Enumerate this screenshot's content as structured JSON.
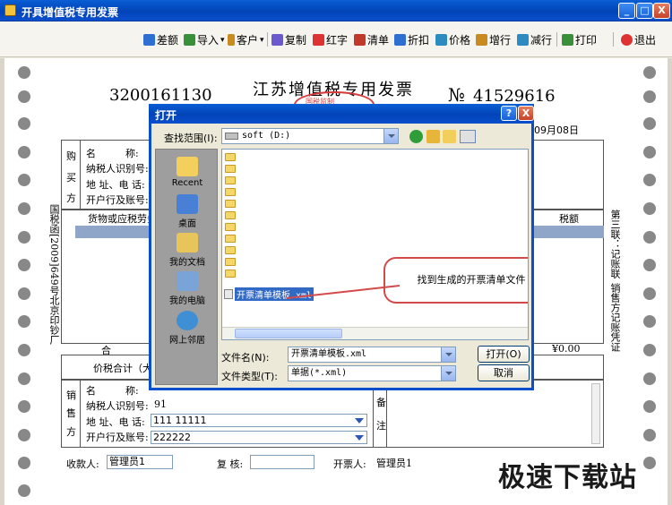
{
  "window": {
    "title": "开具增值税专用发票",
    "min_label": "_",
    "max_label": "□",
    "close_label": "X"
  },
  "toolbar": {
    "items": [
      {
        "label": "差额",
        "color": "#2e6fd1"
      },
      {
        "label": "导入",
        "color": "#3a8f3a"
      },
      {
        "label": "客户",
        "color": "#c98a1f"
      },
      {
        "label": "复制",
        "color": "#6a5acd"
      },
      {
        "label": "红字",
        "color": "#d33"
      },
      {
        "label": "清单",
        "color": "#c0392b"
      },
      {
        "label": "折扣",
        "color": "#2e6fd1"
      },
      {
        "label": "价格",
        "color": "#2e8bc0"
      },
      {
        "label": "增行",
        "color": "#c98a1f"
      },
      {
        "label": "减行",
        "color": "#2e8bc0"
      },
      {
        "label": "打印",
        "color": "#3a8f3a"
      },
      {
        "label": "退出",
        "color": "#d33"
      }
    ],
    "import_arrow": "▾",
    "customer_arrow": "▾"
  },
  "invoice": {
    "title": "江苏增值税专用发票",
    "code": "3200161130",
    "no_label": "№",
    "no_value": "41529616",
    "date": "09月08日",
    "seal_text": "国税监制",
    "buyer_vertical": [
      "购",
      "买",
      "方"
    ],
    "buyer_labels": [
      "名　　　称:",
      "纳税人识别号:",
      "地 址、电 话:",
      "开户行及账号:"
    ],
    "goods_header": "货物或应税劳务、",
    "tax_header": "税额",
    "total_label": "合",
    "total_tax": "¥0.00",
    "price_tax_label": "价税合计（大",
    "left_vertical": "国税函[2009]649号北京印钞厂",
    "right_vertical_1": "第三联：记账联",
    "right_vertical_2": "销售方记账凭证",
    "seller_vertical": [
      "销",
      "售",
      "方"
    ],
    "seller_labels": [
      "名　　　称:",
      "纳税人识别号:",
      "地 址、电 话:",
      "开户行及账号:"
    ],
    "seller_tax_id": "91",
    "seller_address": "111 11111",
    "seller_bank": "222222",
    "remark_vertical": [
      "备",
      "注"
    ],
    "payee_label": "收款人:",
    "payee_value": "管理员1",
    "reviewer_label": "复 核:",
    "reviewer_value": "",
    "drawer_label": "开票人:",
    "drawer_value": "管理员1"
  },
  "watermark": "极速下载站",
  "dialog": {
    "title": "打开",
    "help_label": "?",
    "close_label": "X",
    "lookin_label": "查找范围(I):",
    "lookin_value": "soft (D:)",
    "places": [
      "Recent",
      "桌面",
      "我的文档",
      "我的电脑",
      "网上邻居"
    ],
    "file_name": "开票清单模板.xml",
    "callout": "找到生成的开票清单文件",
    "filename_label": "文件名(N):",
    "filename_value": "开票清单模板.xml",
    "filetype_label": "文件类型(T):",
    "filetype_value": "单据(*.xml)",
    "open_button": "打开(O)",
    "cancel_button": "取消"
  }
}
